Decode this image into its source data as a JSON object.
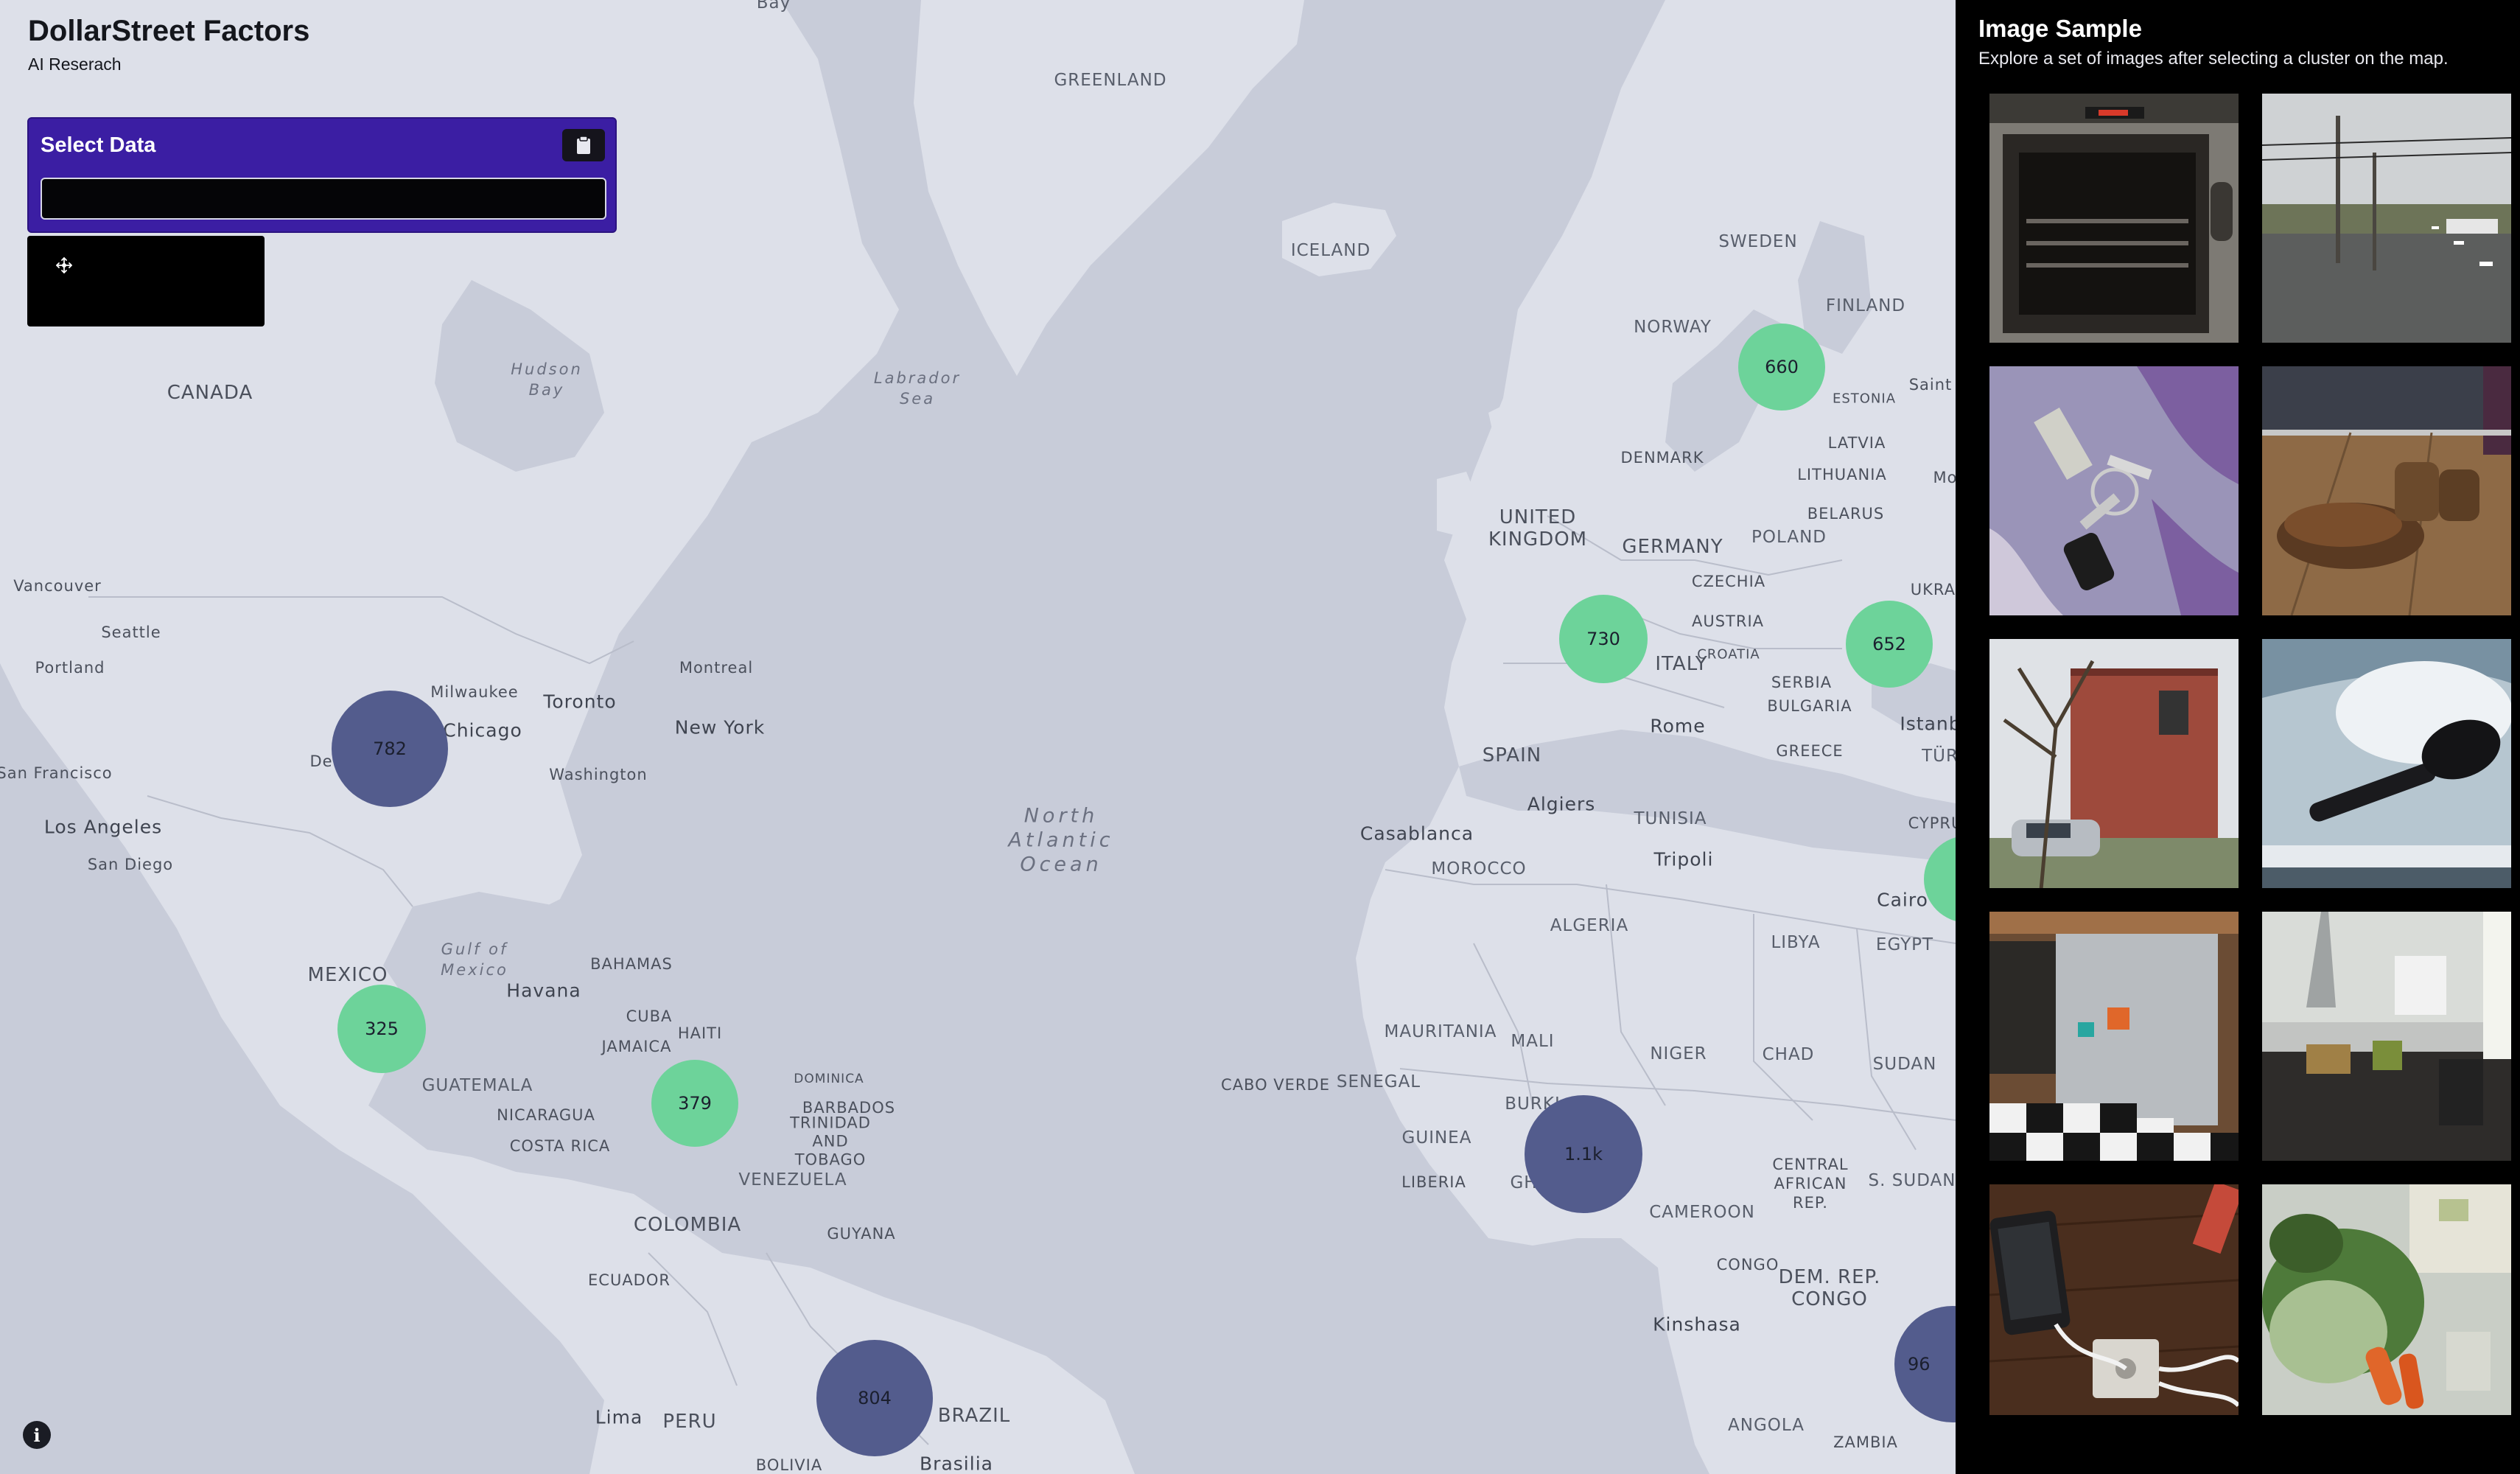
{
  "app": {
    "title": "DollarStreet Factors",
    "subtitle": "AI Reserach"
  },
  "select_panel": {
    "label": "Select Data",
    "input_value": "",
    "clipboard_icon": "clipboard-icon"
  },
  "tool_box": {
    "icon": "move-icon"
  },
  "info_button": {
    "label": "i",
    "icon": "info-icon"
  },
  "side_panel": {
    "title": "Image Sample",
    "description": "Explore a set of images after selecting a cluster on the map.",
    "images": [
      {
        "name": "image-oven"
      },
      {
        "name": "image-street"
      },
      {
        "name": "image-keys"
      },
      {
        "name": "image-shoes"
      },
      {
        "name": "image-house"
      },
      {
        "name": "image-hairbrush"
      },
      {
        "name": "image-fridge"
      },
      {
        "name": "image-kitchen"
      },
      {
        "name": "image-phone-charger"
      },
      {
        "name": "image-vegetables"
      }
    ]
  },
  "map": {
    "labels": {
      "greenland": "GREENLAND",
      "iceland": "ICELAND",
      "canada": "CANADA",
      "hudson_bay": "Hudson Bay",
      "labrador_sea": "Labrador Sea",
      "sweden": "SWEDEN",
      "finland": "FINLAND",
      "norway": "NORWAY",
      "estonia": "ESTONIA",
      "latvia": "LATVIA",
      "denmark": "DENMARK",
      "lithuania": "LITHUANIA",
      "united_kingdom": "UNITED KINGDOM",
      "belarus": "BELARUS",
      "germany": "GERMANY",
      "poland": "POLAND",
      "czechia": "CZECHIA",
      "austria": "AUSTRIA",
      "croatia": "CROATIA",
      "italy": "ITALY",
      "serbia": "SERBIA",
      "bulgaria": "BULGARIA",
      "greece": "GREECE",
      "spain": "SPAIN",
      "rome": "Rome",
      "algiers": "Algiers",
      "tunisia": "TUNISIA",
      "casablanca": "Casablanca",
      "morocco": "MOROCCO",
      "tripoli": "Tripoli",
      "algeria": "ALGERIA",
      "libya": "LIBYA",
      "cairo": "Cairo",
      "egypt": "EGYPT",
      "mauritania": "MAURITANIA",
      "mali": "MALI",
      "niger": "NIGER",
      "chad": "CHAD",
      "sudan": "SUDAN",
      "senegal": "SENEGAL",
      "cabo_verde": "CABO VERDE",
      "guinea": "GUINEA",
      "liberia": "LIBERIA",
      "burkina": "BURKI",
      "gh": "GH",
      "cameroon": "CAMEROON",
      "central_african_rep": "CENTRAL AFRICAN REP.",
      "s_sudan": "S. SUDAN",
      "congo": "CONGO",
      "dem_rep_congo": "DEM. REP. CONGO",
      "kinshasa": "Kinshasa",
      "angola": "ANGOLA",
      "zambia": "ZAMBIA",
      "north_atlantic_ocean": "North Atlantic Ocean",
      "vancouver": "Vancouver",
      "seattle": "Seattle",
      "portland": "Portland",
      "milwaukee": "Milwaukee",
      "toronto": "Toronto",
      "montreal": "Montreal",
      "chicago": "Chicago",
      "new_york": "New York",
      "washington": "Washington",
      "de": "De",
      "san_francisco": "San Francisco",
      "los_angeles": "Los Angeles",
      "san_diego": "San Diego",
      "gulf_of_mexico": "Gulf of Mexico",
      "mexico": "MEXICO",
      "havana": "Havana",
      "bahamas": "BAHAMAS",
      "cuba": "CUBA",
      "haiti": "HAITI",
      "jamaica": "JAMAICA",
      "dominica": "DOMINICA",
      "barbados": "BARBADOS",
      "trinidad": "TRINIDAD AND TOBAGO",
      "guatemala": "GUATEMALA",
      "nicaragua": "NICARAGUA",
      "costa_rica": "COSTA RICA",
      "venezuela": "VENEZUELA",
      "guyana": "GUYANA",
      "colombia": "COLOMBIA",
      "ecuador": "ECUADOR",
      "lima": "Lima",
      "peru": "PERU",
      "brazil": "BRAZIL",
      "brasilia": "Brasilia",
      "bolivia": "BOLIVIA",
      "saint": "Saint",
      "mo": "Mo",
      "ukrai": "UKRAI",
      "istanb": "Istanb",
      "tur": "TÜR",
      "cypru": "CYPRU",
      "bay_top": "Bay"
    },
    "clusters": [
      {
        "name": "cluster-scandinavia",
        "label": "660",
        "color": "green"
      },
      {
        "name": "cluster-france",
        "label": "730",
        "color": "green"
      },
      {
        "name": "cluster-eastern-europe",
        "label": "652",
        "color": "green"
      },
      {
        "name": "cluster-usa",
        "label": "782",
        "color": "blue"
      },
      {
        "name": "cluster-mexico",
        "label": "325",
        "color": "green"
      },
      {
        "name": "cluster-colombia",
        "label": "379",
        "color": "green"
      },
      {
        "name": "cluster-west-africa",
        "label": "1.1k",
        "color": "blue"
      },
      {
        "name": "cluster-brazil",
        "label": "804",
        "color": "blue"
      },
      {
        "name": "cluster-central-africa",
        "label": "96",
        "color": "blue"
      }
    ]
  }
}
